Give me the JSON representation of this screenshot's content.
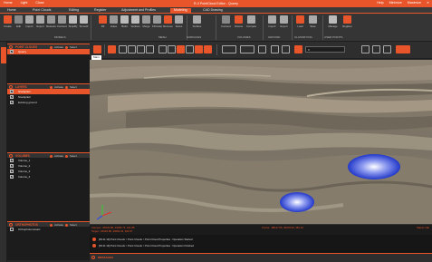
{
  "titlebar": {
    "left_items": [
      "Home",
      "Light",
      "Close"
    ],
    "title": "R-3 PointCloud Editor - Quarry",
    "right_items": [
      "Help",
      "Minimize",
      "Maximize"
    ]
  },
  "menu": {
    "items": [
      "Home",
      "Point Clouds",
      "Editing",
      "Register",
      "Adjustment and Profiles",
      "Modeling",
      "CAD Drawing"
    ],
    "active": "Modeling"
  },
  "ribbon": {
    "groups": [
      "MODELS",
      "MESH",
      "SURFACES",
      "VOLUMES",
      "GROUND",
      "CLASSIFYING",
      "USER POINTS"
    ],
    "buttons": [
      "Create",
      "Edit",
      "Import",
      "Export",
      "Measure",
      "Contours",
      "Simplify",
      "Smooth",
      "Fill",
      "Holes",
      "Build",
      "Vertices",
      "Merge",
      "Fill Holes",
      "Remove",
      "Faces",
      "Surface",
      "Contours",
      "Volume",
      "Compare",
      "Import",
      "Export",
      "Load",
      "Save",
      "Manage",
      "Register"
    ]
  },
  "sidestrip": {
    "tab_label": "Explore"
  },
  "panels": {
    "point_clouds": {
      "title": "POINT CLOUDS",
      "toggle_a": "Activate",
      "toggle_b": "Select",
      "items": [
        {
          "label": "Quarry",
          "checked": true,
          "selected": true
        }
      ]
    },
    "layers": {
      "title": "LAYERS",
      "toggle_a": "Activate",
      "toggle_b": "Select",
      "items": [
        {
          "label": "Stockpile1",
          "checked": true,
          "selected": true
        },
        {
          "label": "Stockpile2",
          "checked": true,
          "selected": false
        },
        {
          "label": "Existing ground",
          "checked": true,
          "selected": false
        }
      ]
    },
    "volumes": {
      "title": "VOLUMES",
      "toggle_a": "Activate",
      "toggle_b": "Select",
      "items": [
        {
          "label": "Volume_1",
          "checked": true
        },
        {
          "label": "Volume_2",
          "checked": true
        },
        {
          "label": "Volume_3",
          "checked": true
        },
        {
          "label": "Volume_4",
          "checked": true
        }
      ]
    },
    "orthophotos": {
      "title": "ORTHOPHOTOS",
      "toggle_a": "Activate",
      "toggle_b": "Select",
      "items": [
        {
          "label": "Orthophotomosaic",
          "checked": false
        }
      ]
    }
  },
  "toolbar": {
    "layer_combo": "0",
    "view_tab": "Main"
  },
  "viewport": {
    "bg_color": "#7d7669",
    "volume_color": "#3a4fd6"
  },
  "status": {
    "line1": "Camera: -98193.88, 40082.73, 441.88",
    "line2": "Target: -98193.88, 40082.43, 363.97",
    "cursor": "Cursor: -98147.55, 40078.46, 381.10",
    "ready": "Status: Idle"
  },
  "console": {
    "lines": [
      "[09:11:19] Point Clouds > Point Clouds > Point Cloud Properties : Operation Started",
      "[09:11:19] Point Clouds > Point Clouds > Point Cloud Properties : Operation Finished"
    ],
    "tab_title": "MESSAGES"
  },
  "colors": {
    "accent": "#e8552a",
    "panel_bg": "#1c1c1c"
  }
}
